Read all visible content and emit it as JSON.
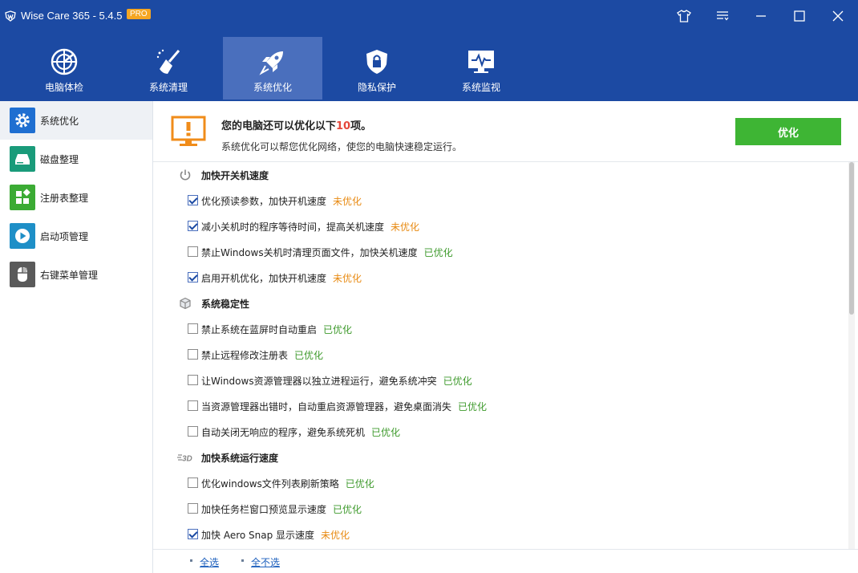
{
  "window": {
    "title": "Wise Care 365 - 5.4.5",
    "badge": "PRO"
  },
  "nav": {
    "tabs": [
      {
        "label": "电脑体检",
        "icon": "radar-icon"
      },
      {
        "label": "系统清理",
        "icon": "broom-icon"
      },
      {
        "label": "系统优化",
        "icon": "rocket-icon",
        "active": true
      },
      {
        "label": "隐私保护",
        "icon": "lock-shield-icon"
      },
      {
        "label": "系统监视",
        "icon": "monitor-pulse-icon"
      }
    ]
  },
  "sidebar": {
    "items": [
      {
        "label": "系统优化",
        "icon": "gear-icon",
        "color": "#1f6fd1",
        "active": true
      },
      {
        "label": "磁盘整理",
        "icon": "disk-icon",
        "color": "#1a9b7a"
      },
      {
        "label": "注册表整理",
        "icon": "registry-icon",
        "color": "#3bab34"
      },
      {
        "label": "启动项管理",
        "icon": "play-icon",
        "color": "#1e8fc7"
      },
      {
        "label": "右键菜单管理",
        "icon": "mouse-icon",
        "color": "#5a5a5a"
      }
    ]
  },
  "header": {
    "title_prefix": "您的电脑还可以优化以下",
    "count": "10",
    "title_suffix": "项。",
    "subtitle": "系统优化可以帮您优化网络，使您的电脑快速稳定运行。",
    "button": "优化",
    "icon_color": "#f08c1a"
  },
  "status": {
    "todo": "未优化",
    "done": "已优化"
  },
  "sections": [
    {
      "title": "加快开关机速度",
      "icon": "power-icon",
      "items": [
        {
          "text": "优化预读参数，加快开机速度",
          "checked": true,
          "status": "未优化"
        },
        {
          "text": "减小关机时的程序等待时间，提高关机速度",
          "checked": true,
          "status": "未优化"
        },
        {
          "text": "禁止Windows关机时清理页面文件，加快关机速度",
          "checked": false,
          "status": "已优化"
        },
        {
          "text": "启用开机优化，加快开机速度",
          "checked": true,
          "status": "未优化"
        }
      ]
    },
    {
      "title": "系统稳定性",
      "icon": "cube-icon",
      "items": [
        {
          "text": "禁止系统在蓝屏时自动重启",
          "checked": false,
          "status": "已优化"
        },
        {
          "text": "禁止远程修改注册表",
          "checked": false,
          "status": "已优化"
        },
        {
          "text": "让Windows资源管理器以独立进程运行，避免系统冲突",
          "checked": false,
          "status": "已优化"
        },
        {
          "text": "当资源管理器出错时，自动重启资源管理器，避免桌面消失",
          "checked": false,
          "status": "已优化"
        },
        {
          "text": "自动关闭无响应的程序，避免系统死机",
          "checked": false,
          "status": "已优化"
        }
      ]
    },
    {
      "title": "加快系统运行速度",
      "icon": "speed-3d-icon",
      "items": [
        {
          "text": "优化windows文件列表刷新策略",
          "checked": false,
          "status": "已优化"
        },
        {
          "text": "加快任务栏窗口预览显示速度",
          "checked": false,
          "status": "已优化"
        },
        {
          "text": "加快 Aero Snap 显示速度",
          "checked": true,
          "status": "未优化"
        }
      ]
    }
  ],
  "footer": {
    "select_all": "全选",
    "select_none": "全不选"
  }
}
